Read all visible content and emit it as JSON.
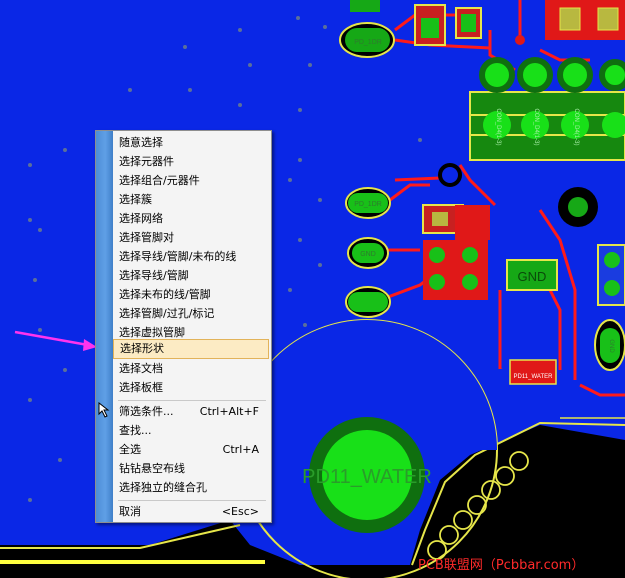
{
  "pcb": {
    "labels": {
      "water_pad": "PD11_WATER",
      "gnd_component": "GND",
      "water_small": "PD11_WATER",
      "pin_a": "PD_1DR",
      "pin_b": "PD_1DR",
      "pin_c": "GND",
      "conn1": "CON_D4(1-3)",
      "conn2": "CON_D4(1-3)",
      "conn3": "CON_D4(1-3)",
      "right_pad": "GND"
    },
    "colors": {
      "board": "#0a27e6",
      "copper_red": "#ff1a1a",
      "pad_green": "#18e018",
      "outline_yellow": "#e6e64a",
      "silk_white": "#e8e8e8"
    }
  },
  "context_menu": {
    "items": [
      {
        "label": "随意选择",
        "shortcut": ""
      },
      {
        "label": "选择元器件",
        "shortcut": ""
      },
      {
        "label": "选择组合/元器件",
        "shortcut": ""
      },
      {
        "label": "选择簇",
        "shortcut": ""
      },
      {
        "label": "选择网络",
        "shortcut": ""
      },
      {
        "label": "选择管脚对",
        "shortcut": ""
      },
      {
        "label": "选择导线/管脚/未布的线",
        "shortcut": ""
      },
      {
        "label": "选择导线/管脚",
        "shortcut": ""
      },
      {
        "label": "选择未布的线/管脚",
        "shortcut": ""
      },
      {
        "label": "选择管脚/过孔/标记",
        "shortcut": ""
      },
      {
        "label": "选择虚拟管脚",
        "shortcut": ""
      },
      {
        "label": "选择形状",
        "shortcut": ""
      },
      {
        "label": "选择文档",
        "shortcut": ""
      },
      {
        "label": "选择板框",
        "shortcut": ""
      },
      {
        "label": "筛选条件...",
        "shortcut": "Ctrl+Alt+F"
      },
      {
        "label": "查找...",
        "shortcut": ""
      },
      {
        "label": "全选",
        "shortcut": "Ctrl+A"
      },
      {
        "label": "钻钻悬空布线",
        "shortcut": ""
      },
      {
        "label": "选择独立的缝合孔",
        "shortcut": ""
      },
      {
        "label": "取消",
        "shortcut": "<Esc>"
      }
    ],
    "highlighted_index": 11
  },
  "watermark": "PCB联盟网（Pcbbar.com）",
  "icons": {
    "pointer": "pink-arrow-icon",
    "cursor": "mouse-cursor-icon"
  }
}
